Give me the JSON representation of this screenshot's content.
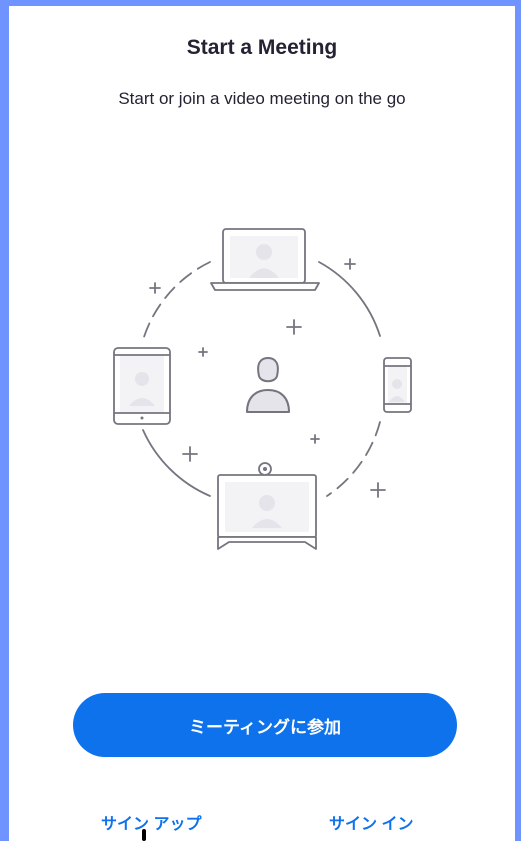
{
  "header": {
    "title": "Start a Meeting",
    "subtitle": "Start or join a video meeting on the go"
  },
  "illustration": {
    "icon": "video-meeting-devices-illustration"
  },
  "actions": {
    "join_label": "ミーティングに参加",
    "signup_label": "サイン アップ",
    "signin_label": "サイン イン"
  },
  "colors": {
    "accent": "#0e72ed",
    "frame": "#6f93ff",
    "text": "#232333",
    "illustration_stroke": "#75757f",
    "illustration_fill": "#e4e4ea"
  }
}
